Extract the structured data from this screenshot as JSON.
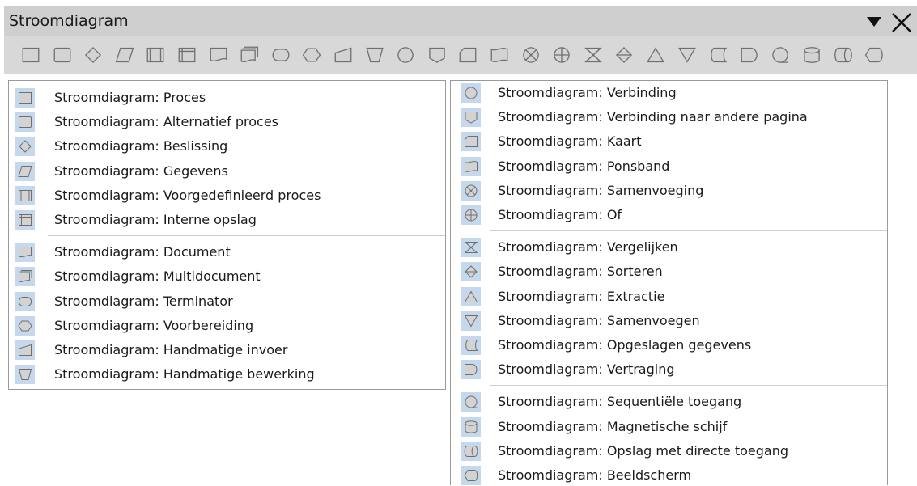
{
  "window": {
    "title": "Stroomdiagram"
  },
  "toolbar": {
    "shapes": [
      "process",
      "alternate-process",
      "decision",
      "data",
      "predefined-process",
      "internal-storage",
      "document",
      "multidocument",
      "terminator",
      "preparation",
      "manual-input",
      "manual-operation",
      "connector",
      "off-page-connector",
      "card",
      "punched-tape",
      "summing-junction",
      "or",
      "collate",
      "sort",
      "extract",
      "merge",
      "stored-data",
      "delay",
      "sequential-access",
      "magnetic-disk",
      "direct-access-storage",
      "display"
    ]
  },
  "left_menu": {
    "items": [
      {
        "label": "Stroomdiagram: Proces",
        "icon": "process"
      },
      {
        "label": "Stroomdiagram: Alternatief proces",
        "icon": "alternate-process"
      },
      {
        "label": "Stroomdiagram: Beslissing",
        "icon": "decision"
      },
      {
        "label": "Stroomdiagram: Gegevens",
        "icon": "data"
      },
      {
        "label": "Stroomdiagram: Voorgedefinieerd proces",
        "icon": "predefined-process"
      },
      {
        "label": "Stroomdiagram: Interne opslag",
        "icon": "internal-storage"
      },
      {
        "label": "Stroomdiagram: Document",
        "icon": "document"
      },
      {
        "label": "Stroomdiagram: Multidocument",
        "icon": "multidocument"
      },
      {
        "label": "Stroomdiagram: Terminator",
        "icon": "terminator"
      },
      {
        "label": "Stroomdiagram: Voorbereiding",
        "icon": "preparation"
      },
      {
        "label": "Stroomdiagram: Handmatige invoer",
        "icon": "manual-input"
      },
      {
        "label": "Stroomdiagram: Handmatige bewerking",
        "icon": "manual-operation"
      }
    ]
  },
  "right_menu": {
    "items": [
      {
        "label": "Stroomdiagram: Verbinding",
        "icon": "connector"
      },
      {
        "label": "Stroomdiagram: Verbinding naar andere pagina",
        "icon": "off-page-connector"
      },
      {
        "label": "Stroomdiagram: Kaart",
        "icon": "card"
      },
      {
        "label": "Stroomdiagram: Ponsband",
        "icon": "punched-tape"
      },
      {
        "label": "Stroomdiagram: Samenvoeging",
        "icon": "summing-junction"
      },
      {
        "label": "Stroomdiagram: Of",
        "icon": "or"
      },
      {
        "label": "Stroomdiagram: Vergelijken",
        "icon": "collate"
      },
      {
        "label": "Stroomdiagram: Sorteren",
        "icon": "sort"
      },
      {
        "label": "Stroomdiagram: Extractie",
        "icon": "extract"
      },
      {
        "label": "Stroomdiagram: Samenvoegen",
        "icon": "merge"
      },
      {
        "label": "Stroomdiagram: Opgeslagen gegevens",
        "icon": "stored-data"
      },
      {
        "label": "Stroomdiagram: Vertraging",
        "icon": "delay"
      },
      {
        "label": "Stroomdiagram: Sequentiële toegang",
        "icon": "sequential-access"
      },
      {
        "label": "Stroomdiagram: Magnetische schijf",
        "icon": "magnetic-disk"
      },
      {
        "label": "Stroomdiagram: Opslag met directe toegang",
        "icon": "direct-access-storage"
      },
      {
        "label": "Stroomdiagram: Beeldscherm",
        "icon": "display"
      }
    ]
  },
  "colors": {
    "icon_highlight": "#c6d8ec",
    "shape_fill": "#d3d3d3",
    "shape_stroke": "#6f6f6f",
    "titlebar": "#cfcfcf",
    "toolbar": "#d8d8d8"
  }
}
